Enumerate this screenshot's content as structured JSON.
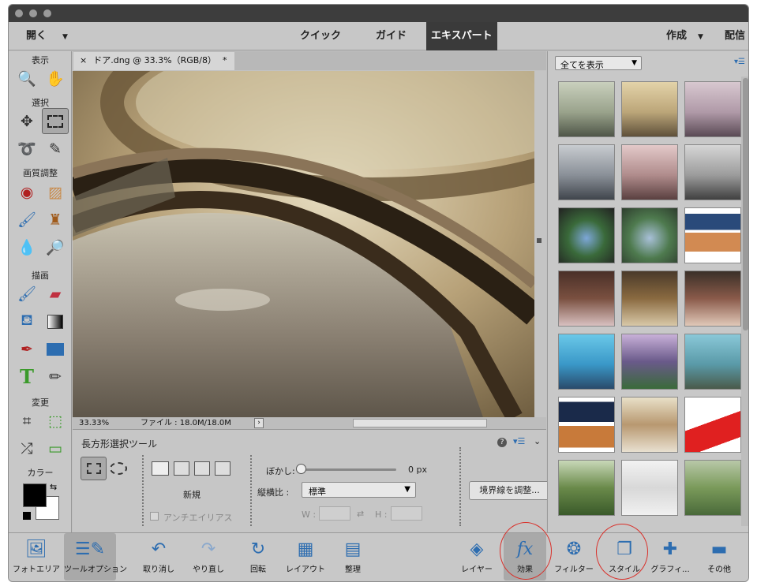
{
  "menubar": {
    "open_label": "開く",
    "modes": [
      "クイック",
      "ガイド",
      "エキスパート"
    ],
    "active_mode": "エキスパート",
    "create_label": "作成",
    "share_label": "配信"
  },
  "toolbox": {
    "sections": [
      "表示",
      "選択",
      "画質調整",
      "描画",
      "変更",
      "カラー"
    ]
  },
  "document": {
    "tab_title": "ドア.dng @ 33.3%（RGB/8）",
    "tab_modified": "*",
    "close_glyph": "×",
    "zoom": "33.33%",
    "file_info": "ファイル : 18.0M/18.0M"
  },
  "tool_options": {
    "tool_name": "長方形選択ツール",
    "new_label": "新規",
    "antialias_label": "アンチエイリアス",
    "feather_label": "ぼかし:",
    "feather_value": "0 px",
    "aspect_label": "縦横比 :",
    "aspect_value": "標準",
    "w_label": "W :",
    "h_label": "H :",
    "refine_edge_label": "境界線を調整..."
  },
  "right_panel": {
    "filter_value": "全てを表示"
  },
  "bottom_bar": {
    "items": [
      "フォトエリア",
      "ツールオプション",
      "取り消し",
      "やり直し",
      "回転",
      "レイアウト",
      "整理",
      "レイヤー",
      "効果",
      "フィルター",
      "スタイル",
      "グラフィ...",
      "その他"
    ]
  },
  "colors": {
    "menubar_active_bg": "#3a3a3a",
    "icon_blue": "#2d6db0",
    "highlight_circle": "#d9302a"
  }
}
